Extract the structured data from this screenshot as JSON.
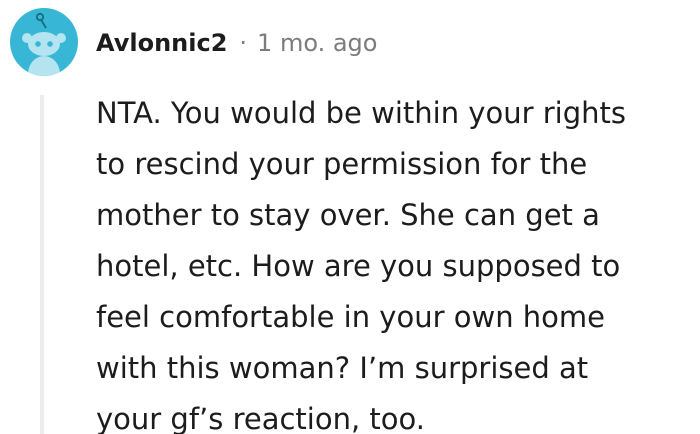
{
  "comment": {
    "username": "Avlonnic2",
    "separator": "·",
    "timestamp": "1 mo. ago",
    "avatar_icon": "snoo-avatar-icon",
    "avatar_color": "#37b6d6",
    "body_lines": [
      "NTA. You would be within your rights",
      "to rescind your permission for the",
      "mother to stay over. She can get a",
      "hotel, etc. How are you supposed to",
      "feel comfortable in your own home",
      "with this woman? I’m surprised at",
      "your gf’s reaction, too."
    ]
  }
}
